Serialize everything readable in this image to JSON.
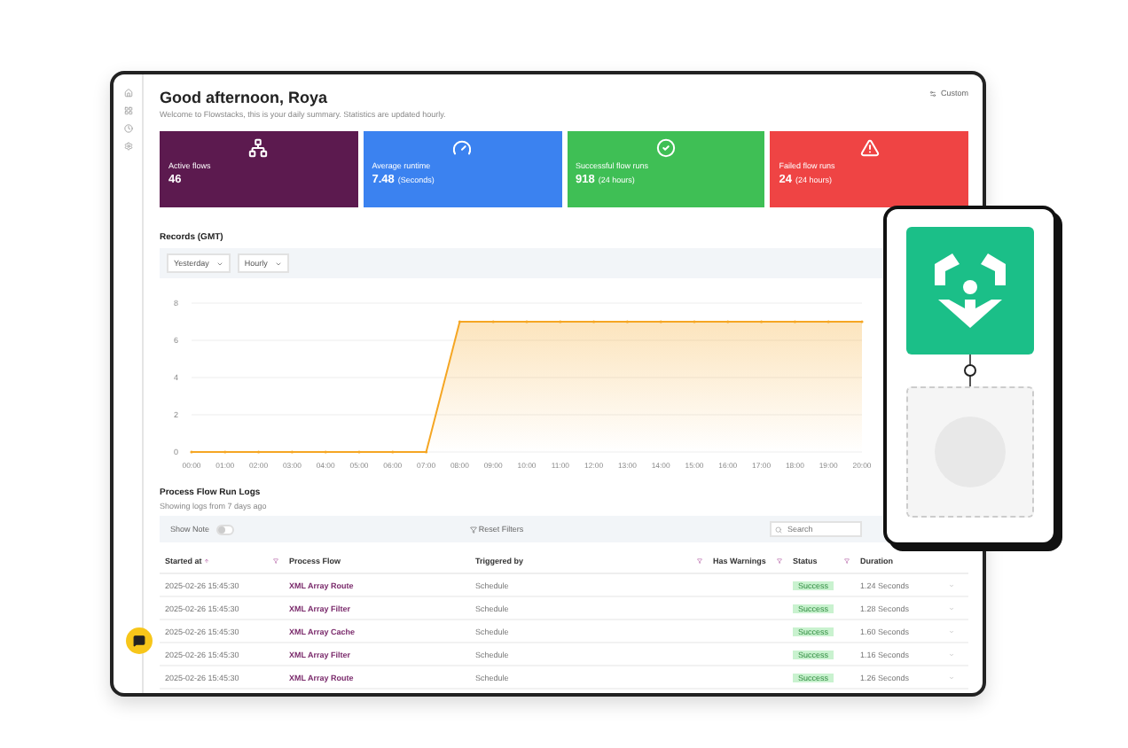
{
  "header": {
    "greeting": "Good afternoon, Roya",
    "subtitle": "Welcome to Flowstacks, this is your daily summary. Statistics are updated hourly.",
    "custom_button": "Custom"
  },
  "stat_cards": [
    {
      "kind": "flows",
      "label": "Active flows",
      "value": "46",
      "color": "#5c1a4f"
    },
    {
      "kind": "gauge",
      "label": "Average runtime",
      "value": "7.48",
      "unit": "(Seconds)",
      "color": "#3b82f0"
    },
    {
      "kind": "check",
      "label": "Successful flow runs",
      "value": "918",
      "unit": "(24 hours)",
      "color": "#3fbf55"
    },
    {
      "kind": "warning",
      "label": "Failed flow runs",
      "value": "24",
      "unit": "(24 hours)",
      "color": "#ef4444"
    }
  ],
  "records": {
    "title": "Records (GMT)",
    "filters": [
      "Yesterday",
      "Hourly"
    ],
    "chart_data": {
      "type": "area",
      "categories": [
        "00:00",
        "01:00",
        "02:00",
        "03:00",
        "04:00",
        "05:00",
        "06:00",
        "07:00",
        "08:00",
        "09:00",
        "10:00",
        "11:00",
        "12:00",
        "13:00",
        "14:00",
        "15:00",
        "16:00",
        "17:00",
        "18:00",
        "19:00",
        "20:00"
      ],
      "values": [
        0,
        0,
        0,
        0,
        0,
        0,
        0,
        0,
        7,
        7,
        7,
        7,
        7,
        7,
        7,
        7,
        7,
        7,
        7,
        7,
        7
      ],
      "ylim": [
        0,
        8
      ],
      "yticks": [
        0,
        2,
        4,
        6,
        8
      ],
      "grid": true
    }
  },
  "logs": {
    "title": "Process Flow Run Logs",
    "subtitle": "Showing logs from 7 days ago",
    "show_note": {
      "label": "Show Note",
      "on": false
    },
    "reset_filters": "Reset Filters",
    "search": {
      "placeholder": "Search"
    },
    "columns": [
      "Started at",
      "Process Flow",
      "Triggered by",
      "Has Warnings",
      "Status",
      "Duration"
    ],
    "rows": [
      {
        "started": "2025-02-26 15:45:30",
        "flow": "XML Array Route",
        "trigger": "Schedule",
        "status": "Success",
        "duration": "1.24 Seconds"
      },
      {
        "started": "2025-02-26 15:45:30",
        "flow": "XML Array Filter",
        "trigger": "Schedule",
        "status": "Success",
        "duration": "1.28 Seconds"
      },
      {
        "started": "2025-02-26 15:45:30",
        "flow": "XML Array Cache",
        "trigger": "Schedule",
        "status": "Success",
        "duration": "1.60 Seconds"
      },
      {
        "started": "2025-02-26 15:45:30",
        "flow": "XML Array Filter",
        "trigger": "Schedule",
        "status": "Success",
        "duration": "1.16 Seconds"
      },
      {
        "started": "2025-02-26 15:45:30",
        "flow": "XML Array Route",
        "trigger": "Schedule",
        "status": "Success",
        "duration": "1.26 Seconds"
      }
    ]
  }
}
